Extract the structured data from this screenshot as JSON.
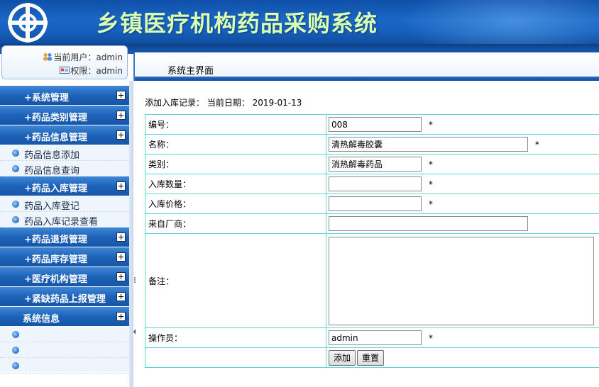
{
  "app": {
    "title": "乡镇医疗机构药品采购系统"
  },
  "user": {
    "current_user_label": "当前用户：admin",
    "role_label": "权限：admin"
  },
  "tab": {
    "title": "系统主界面"
  },
  "sidebar": {
    "menus": [
      {
        "label": "系统管理",
        "prefix": "+"
      },
      {
        "label": "药品类别管理",
        "prefix": "+"
      },
      {
        "label": "药品信息管理",
        "prefix": "+",
        "items": [
          "药品信息添加",
          "药品信息查询"
        ]
      },
      {
        "label": "药品入库管理",
        "prefix": "+",
        "items": [
          "药品入库登记",
          "药品入库记录查看"
        ]
      },
      {
        "label": "药品退货管理",
        "prefix": "+"
      },
      {
        "label": "药品库存管理",
        "prefix": "+"
      },
      {
        "label": "医疗机构管理",
        "prefix": "+"
      },
      {
        "label": "紧缺药品上报管理",
        "prefix": "+"
      },
      {
        "label": "系统信息",
        "prefix": ""
      }
    ]
  },
  "form": {
    "heading": "添加入库记录：  当前日期： 2019-01-13",
    "required_mark": "*",
    "fields": {
      "code": {
        "label": "编号：",
        "value": "008"
      },
      "name": {
        "label": "名称：",
        "value": "清热解毒胶囊"
      },
      "category": {
        "label": "类别：",
        "value": "消热解毒药品"
      },
      "quantity": {
        "label": "入库数量：",
        "value": ""
      },
      "price": {
        "label": "入库价格：",
        "value": ""
      },
      "vendor": {
        "label": "来自厂商：",
        "value": ""
      },
      "remark": {
        "label": "备注：",
        "value": ""
      },
      "operator": {
        "label": "操作员：",
        "value": "admin"
      }
    },
    "buttons": {
      "add": "添加",
      "reset": "重置"
    }
  },
  "colors": {
    "header_blue": "#1b67c5",
    "title_green": "#d8ffb4",
    "table_border": "#5fd6dc",
    "menu_blue": "#1d63b9"
  }
}
